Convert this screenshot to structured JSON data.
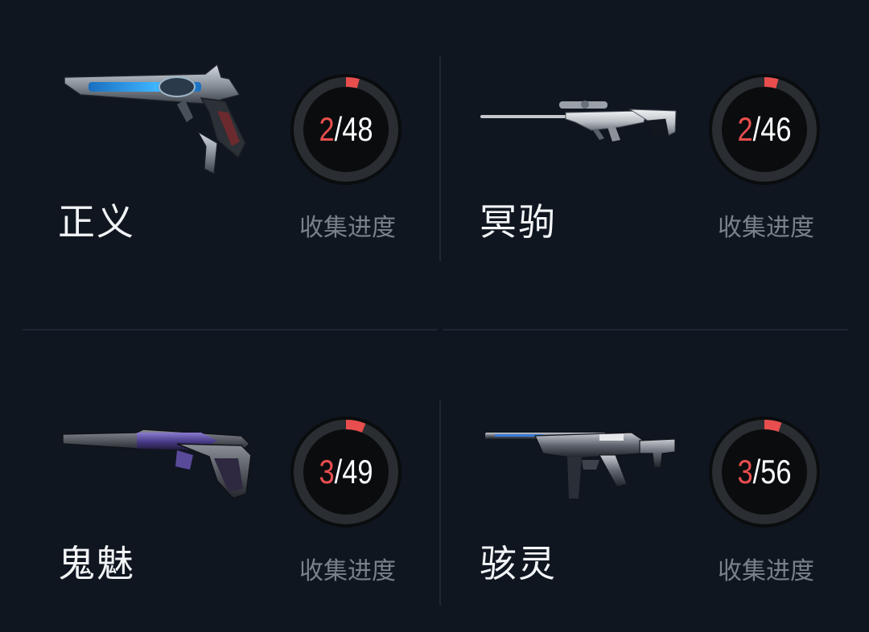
{
  "cards": [
    {
      "name": "正义",
      "collected": "2",
      "total": "48",
      "progress_label": "收集进度",
      "progress": 0.0417,
      "icon": "sheriff-revolver-icon"
    },
    {
      "name": "冥驹",
      "collected": "2",
      "total": "46",
      "progress_label": "收集进度",
      "progress": 0.0435,
      "icon": "marshal-sniper-icon"
    },
    {
      "name": "鬼魅",
      "collected": "3",
      "total": "49",
      "progress_label": "收集进度",
      "progress": 0.0612,
      "icon": "ghost-pistol-icon"
    },
    {
      "name": "骇灵",
      "collected": "3",
      "total": "56",
      "progress_label": "收集进度",
      "progress": 0.0536,
      "icon": "spectre-smg-icon"
    }
  ],
  "colors": {
    "background": "#0f1620",
    "ring_track": "#2a2d31",
    "ring_progress": "#e84e4e",
    "collected_text": "#e84e4e",
    "label_text": "#7b8189",
    "divider": "#1e2733"
  }
}
